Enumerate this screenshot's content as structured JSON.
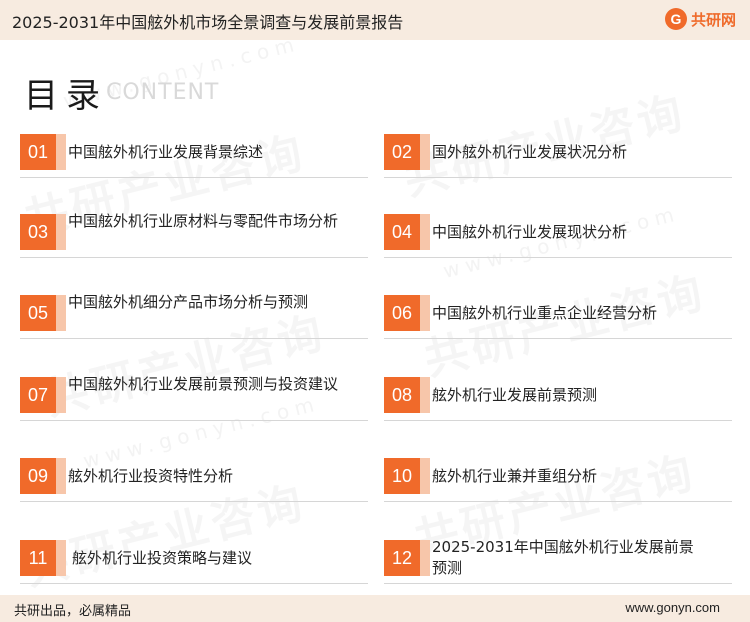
{
  "header": {
    "title": "2025-2031年中国舷外机市场全景调查与发展前景报告",
    "logo_mark": "G",
    "logo_text": "共研网"
  },
  "watermark": {
    "text": "共研产业咨询",
    "sub": "www.gonyn.com"
  },
  "toc": {
    "heading": "目录",
    "subheading": "CONTENT",
    "items": [
      {
        "num": "01",
        "label": "中国舷外机行业发展背景综述"
      },
      {
        "num": "02",
        "label": "国外舷外机行业发展状况分析"
      },
      {
        "num": "03",
        "label": "中国舷外机行业原材料与零配件市场分析"
      },
      {
        "num": "04",
        "label": "中国舷外机行业发展现状分析"
      },
      {
        "num": "05",
        "label": "中国舷外机细分产品市场分析与预测"
      },
      {
        "num": "06",
        "label": "中国舷外机行业重点企业经营分析"
      },
      {
        "num": "07",
        "label": "中国舷外机行业发展前景预测与投资建议"
      },
      {
        "num": "08",
        "label": "舷外机行业发展前景预测"
      },
      {
        "num": "09",
        "label": "舷外机行业投资特性分析"
      },
      {
        "num": "10",
        "label": "舷外机行业兼并重组分析"
      },
      {
        "num": "11",
        "label": "舷外机行业投资策略与建议"
      },
      {
        "num": "12",
        "label": "2025-2031年中国舷外机行业发展前景预测"
      }
    ]
  },
  "footer": {
    "slogan": "共研出品，必属精品",
    "url": "www.gonyn.com"
  },
  "colors": {
    "accent": "#f06a2a",
    "accent_light": "#f7c6aa",
    "bar_bg": "#f7ebe0"
  }
}
